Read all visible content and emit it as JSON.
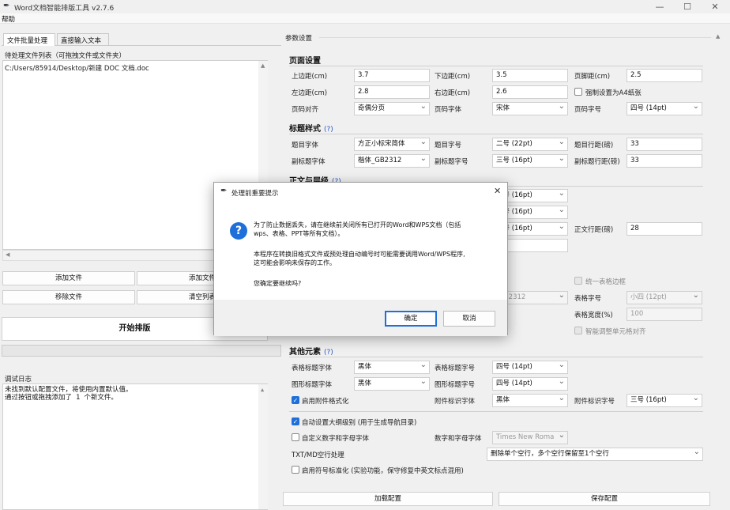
{
  "window": {
    "title": "Word文档智能排版工具 v2.7.6",
    "min": "—",
    "max": "☐",
    "close": "✕"
  },
  "menu": {
    "help": "帮助"
  },
  "tabs": [
    "文件批量处理",
    "直接输入文本"
  ],
  "file_list": {
    "label": "待处理文件列表（可拖拽文件或文件夹）",
    "items": [
      "C:/Users/85914/Desktop/新建 DOC 文档.doc"
    ]
  },
  "buttons": {
    "add_file": "添加文件",
    "add_folder": "添加文件",
    "remove_file": "移除文件",
    "clear_list": "清空列表",
    "start": "开始排版",
    "load_config": "加载配置",
    "save_config": "保存配置"
  },
  "log": {
    "label": "调试日志",
    "lines": [
      "未找到默认配置文件，将使用内置默认值。",
      "通过按钮或拖拽添加了 1 个新文件。"
    ]
  },
  "params": {
    "frame_label": "参数设置",
    "page_setup": {
      "title": "页面设置",
      "top_margin_label": "上边距(cm)",
      "top_margin": "3.7",
      "bottom_margin_label": "下边距(cm)",
      "bottom_margin": "3.5",
      "footer_margin_label": "页脚距(cm)",
      "footer_margin": "2.5",
      "left_margin_label": "左边距(cm)",
      "left_margin": "2.8",
      "right_margin_label": "右边距(cm)",
      "right_margin": "2.6",
      "force_a4_label": "强制设置为A4纸张",
      "page_num_align_label": "页码对齐",
      "page_num_align": "奇偶分页",
      "page_num_font_label": "页码字体",
      "page_num_font": "宋体",
      "page_num_size_label": "页码字号",
      "page_num_size": "四号 (14pt)"
    },
    "title_style": {
      "title": "标题样式",
      "help": "(?)",
      "title_font_label": "题目字体",
      "title_font": "方正小标宋简体",
      "title_size_label": "题目字号",
      "title_size": "二号 (22pt)",
      "title_spacing_label": "题目行距(磅)",
      "title_spacing": "33",
      "subtitle_font_label": "副标题字体",
      "subtitle_font": "楷体_GB2312",
      "subtitle_size_label": "副标题字号",
      "subtitle_size": "三号 (16pt)",
      "subtitle_spacing_label": "副标题行距(磅)",
      "subtitle_spacing": "33"
    },
    "body_levels": {
      "title": "正文与层级",
      "help": "(?)",
      "size1": "三号 (16pt)",
      "size2": "三号 (16pt)",
      "size3": "三号 (16pt)",
      "body_spacing_label": "正文行距(磅)",
      "body_spacing": "28"
    },
    "table": {
      "unify_border_label": "统一表格边框",
      "table_font_partial": "_GB2312",
      "table_size_label": "表格字号",
      "table_size": "小四 (12pt)",
      "table_width_label": "表格宽度(%)",
      "table_width": "100",
      "smart_align_label": "智能调整单元格对齐"
    },
    "other": {
      "title": "其他元素",
      "help": "(?)",
      "table_title_font_label": "表格标题字体",
      "table_title_font": "黑体",
      "table_title_size_label": "表格标题字号",
      "table_title_size": "四号 (14pt)",
      "figure_title_font_label": "图形标题字体",
      "figure_title_font": "黑体",
      "figure_title_size_label": "图形标题字号",
      "figure_title_size": "四号 (14pt)",
      "enable_attach_label": "启用附件格式化",
      "attach_font_label": "附件标识字体",
      "attach_font": "黑体",
      "attach_size_label": "附件标识字号",
      "attach_size": "三号 (16pt)",
      "auto_outline_label": "自动设置大纲级别 (用于生成导航目录)",
      "custom_font_label": "自定义数字和字母字体",
      "num_font_label": "数字和字母字体",
      "num_font": "Times New Roma",
      "txt_blank_label": "TXT/MD空行处理",
      "txt_blank": "删除单个空行，多个空行保留至1个空行",
      "punct_label": "启用符号标准化 (实验功能，保守修复中英文标点混用)"
    }
  },
  "dialog": {
    "title": "处理前重要提示",
    "close": "✕",
    "line1": "为了防止数据丢失，请在继续前关闭所有已打开的Word和WPS文档（包括",
    "line2": "wps、表格、PPT等所有文档）。",
    "line3": "本程序在转换旧格式文件或预处理自动编号时可能需要调用Word/WPS程序,",
    "line4": "这可能会影响未保存的工作。",
    "line5": "您确定要继续吗?",
    "ok": "确定",
    "cancel": "取消"
  }
}
